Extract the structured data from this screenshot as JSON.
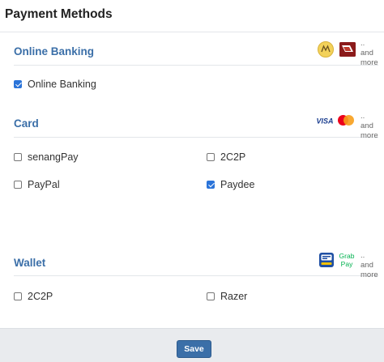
{
  "header": {
    "title": "Payment Methods"
  },
  "sections": {
    "online_banking": {
      "title": "Online Banking",
      "more_text": ".. and more",
      "logos": [
        "maybank-logo",
        "cimb-logo"
      ],
      "options": [
        {
          "label": "Online Banking",
          "checked": true
        }
      ]
    },
    "card": {
      "title": "Card",
      "more_text": ".. and more",
      "logos": [
        "visa-logo",
        "mastercard-logo"
      ],
      "visa_text": "VISA",
      "options": [
        {
          "label": "senangPay",
          "checked": false
        },
        {
          "label": "2C2P",
          "checked": false
        },
        {
          "label": "PayPal",
          "checked": false
        },
        {
          "label": "Paydee",
          "checked": true
        }
      ]
    },
    "wallet": {
      "title": "Wallet",
      "more_text": ".. and more",
      "logos": [
        "touch-n-go-logo",
        "grabpay-logo"
      ],
      "grab_text": "Grab",
      "pay_text": "Pay",
      "options": [
        {
          "label": "2C2P",
          "checked": false
        },
        {
          "label": "Razer",
          "checked": false
        }
      ]
    }
  },
  "footer": {
    "save_label": "Save"
  },
  "colors": {
    "accent": "#3b6fa8",
    "checkbox_checked": "#2b74d9",
    "footer_bg": "#e9ebee"
  }
}
